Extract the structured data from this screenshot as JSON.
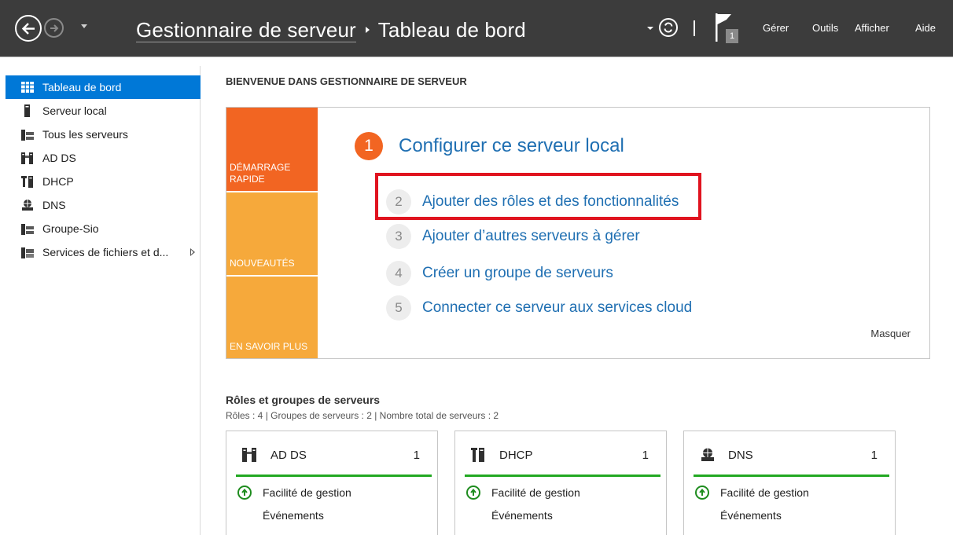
{
  "header": {
    "app_title": "Gestionnaire de serveur",
    "page_title": "Tableau de bord",
    "notification_count": "1",
    "menus": [
      "Gérer",
      "Outils",
      "Afficher",
      "Aide"
    ]
  },
  "sidebar": {
    "items": [
      {
        "label": "Tableau de bord",
        "icon": "dashboard-icon",
        "active": true
      },
      {
        "label": "Serveur local",
        "icon": "server-icon"
      },
      {
        "label": "Tous les serveurs",
        "icon": "servers-icon"
      },
      {
        "label": "AD DS",
        "icon": "ad-ds-icon"
      },
      {
        "label": "DHCP",
        "icon": "dhcp-icon"
      },
      {
        "label": "DNS",
        "icon": "dns-icon"
      },
      {
        "label": "Groupe-Sio",
        "icon": "group-icon"
      },
      {
        "label": "Services de fichiers et d...",
        "icon": "file-services-icon",
        "expandable": true
      }
    ]
  },
  "main": {
    "welcome": "BIENVENUE DANS GESTIONNAIRE DE SERVEUR",
    "quick_start": {
      "tiles": [
        "DÉMARRAGE RAPIDE",
        "NOUVEAUTÉS",
        "EN SAVOIR PLUS"
      ],
      "primary_step": {
        "number": "1",
        "label": "Configurer ce serveur local"
      },
      "steps": [
        {
          "number": "2",
          "label": "Ajouter des rôles et des fonctionnalités"
        },
        {
          "number": "3",
          "label": "Ajouter d’autres serveurs à gérer"
        },
        {
          "number": "4",
          "label": "Créer un groupe de serveurs"
        },
        {
          "number": "5",
          "label": "Connecter ce serveur aux services cloud"
        }
      ],
      "hide_label": "Masquer"
    },
    "roles": {
      "title": "Rôles et groupes de serveurs",
      "summary": "Rôles : 4  |  Groupes de serveurs : 2  |  Nombre total de serveurs : 2",
      "cards": [
        {
          "name": "AD DS",
          "count": "1",
          "icon": "ad-ds-icon",
          "status": "Facilité de gestion",
          "events": "Événements"
        },
        {
          "name": "DHCP",
          "count": "1",
          "icon": "dhcp-icon",
          "status": "Facilité de gestion",
          "events": "Événements"
        },
        {
          "name": "DNS",
          "count": "1",
          "icon": "dns-icon",
          "status": "Facilité de gestion",
          "events": "Événements"
        }
      ]
    }
  },
  "colors": {
    "topbar": "#3c3c3c",
    "selection": "#0078d7",
    "tile_dark_orange": "#f26522",
    "tile_orange": "#f6a93b",
    "link_blue": "#1f6fb2",
    "highlight_red": "#e0131f",
    "status_green": "#22a822"
  }
}
